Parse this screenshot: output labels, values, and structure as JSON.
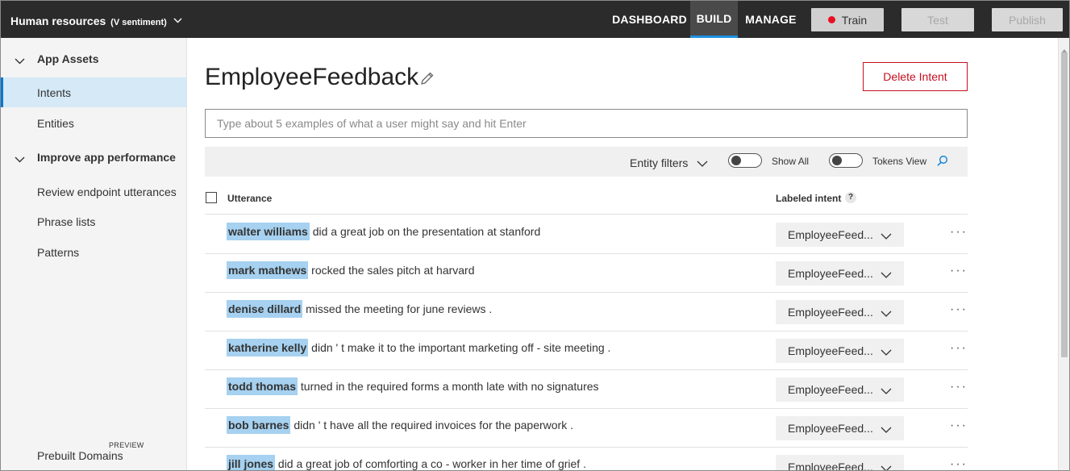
{
  "header": {
    "app_name": "Human resources",
    "app_sub": "(V sentiment)",
    "nav": [
      "DASHBOARD",
      "BUILD",
      "MANAGE"
    ],
    "active_nav": "BUILD",
    "train_label": "Train",
    "test_label": "Test",
    "publish_label": "Publish",
    "colors": {
      "bar": "#2b2b2b",
      "active_underline": "#1e90e0",
      "train_dot": "#e81123"
    }
  },
  "sidebar": {
    "sections": [
      {
        "label": "App Assets",
        "items": [
          "Intents",
          "Entities"
        ]
      },
      {
        "label": "Improve app performance",
        "items": [
          "Review endpoint utterances",
          "Phrase lists",
          "Patterns"
        ]
      }
    ],
    "active_item": "Intents",
    "footer_item": "Prebuilt Domains",
    "footer_tag": "PREVIEW"
  },
  "main": {
    "title": "EmployeeFeedback",
    "delete_label": "Delete Intent",
    "input_placeholder": "Type about 5 examples of what a user might say and hit Enter",
    "filters": {
      "entity_filters": "Entity filters",
      "show_all": "Show All",
      "tokens_view": "Tokens View"
    },
    "table": {
      "col_utterance": "Utterance",
      "col_intent": "Labeled intent",
      "help": "?",
      "rows": [
        {
          "entity": "walter williams",
          "text": "did a great job on the presentation at stanford",
          "intent": "EmployeeFeed..."
        },
        {
          "entity": "mark mathews",
          "text": "rocked the sales pitch at harvard",
          "intent": "EmployeeFeed..."
        },
        {
          "entity": "denise dillard",
          "text": "missed the meeting for june reviews .",
          "intent": "EmployeeFeed..."
        },
        {
          "entity": "katherine kelly",
          "text": "didn ' t make it to the important marketing off - site meeting .",
          "intent": "EmployeeFeed..."
        },
        {
          "entity": "todd thomas",
          "text": "turned in the required forms a month late with no signatures",
          "intent": "EmployeeFeed..."
        },
        {
          "entity": "bob barnes",
          "text": "didn ' t have all the required invoices for the paperwork .",
          "intent": "EmployeeFeed..."
        },
        {
          "entity": "jill jones",
          "text": "did a great job of comforting a co - worker in her time of grief .",
          "intent": "EmployeeFeed..."
        }
      ],
      "more_label": "···"
    },
    "colors": {
      "entity_highlight": "#a6d1f0",
      "delete_red": "#c50f1f",
      "active_blue": "#0078d4"
    }
  }
}
